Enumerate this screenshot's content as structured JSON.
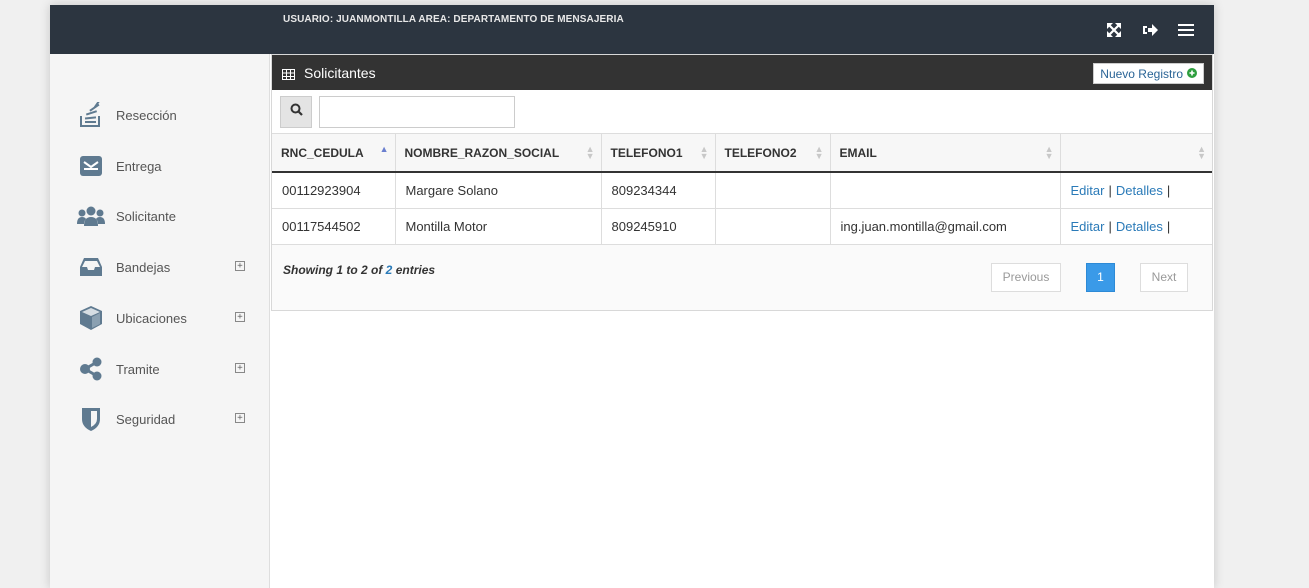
{
  "header": {
    "user_info": "USUARIO: JUANMONTILLA AREA: DEPARTAMENTO DE MENSAJERIA",
    "icons": [
      "expand-icon",
      "logout-icon",
      "menu-icon"
    ]
  },
  "sidebar": {
    "items": [
      {
        "label": "Resección",
        "icon": "stack-icon",
        "expandable": false
      },
      {
        "label": "Entrega",
        "icon": "envelope-icon",
        "expandable": false
      },
      {
        "label": "Solicitante",
        "icon": "users-icon",
        "expandable": false
      },
      {
        "label": "Bandejas",
        "icon": "inbox-icon",
        "expandable": true
      },
      {
        "label": "Ubicaciones",
        "icon": "cube-icon",
        "expandable": true
      },
      {
        "label": "Tramite",
        "icon": "share-icon",
        "expandable": true
      },
      {
        "label": "Seguridad",
        "icon": "shield-icon",
        "expandable": true
      }
    ],
    "expand_symbol": "+"
  },
  "panel": {
    "title": "Solicitantes",
    "new_button": "Nuevo Registro"
  },
  "search": {
    "value": "",
    "placeholder": ""
  },
  "table": {
    "columns": [
      "RNC_CEDULA",
      "NOMBRE_RAZON_SOCIAL",
      "TELEFONO1",
      "TELEFONO2",
      "EMAIL",
      ""
    ],
    "rows": [
      {
        "rnc": "00112923904",
        "nombre": "Margare Solano",
        "tel1": "809234344",
        "tel2": "",
        "email": ""
      },
      {
        "rnc": "00117544502",
        "nombre": "Montilla Motor",
        "tel1": "809245910",
        "tel2": "",
        "email": "ing.juan.montilla@gmail.com"
      }
    ],
    "actions": {
      "edit": "Editar",
      "details": "Detalles",
      "separator": "|"
    }
  },
  "footer": {
    "info_prefix": "Showing 1 to 2 of",
    "info_total": "2",
    "info_suffix": "entries",
    "previous": "Previous",
    "page": "1",
    "next": "Next"
  },
  "colors": {
    "topbar": "#2c3540",
    "panel_header": "#333333",
    "link": "#2a7ab8",
    "active_page": "#3a9ae8",
    "new_icon": "#2e9e3e"
  }
}
